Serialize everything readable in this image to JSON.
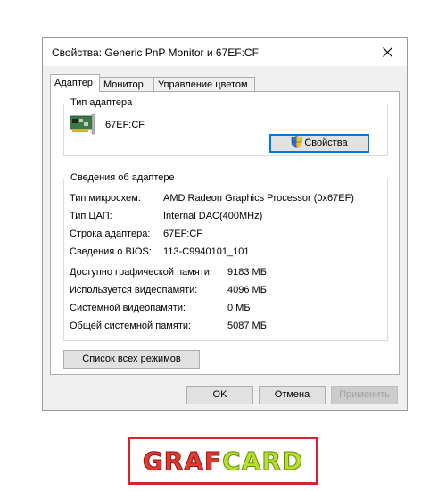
{
  "window": {
    "title": "Свойства: Generic PnP Monitor и 67EF:CF"
  },
  "tabs": [
    {
      "label": "Адаптер",
      "active": true
    },
    {
      "label": "Монитор",
      "active": false
    },
    {
      "label": "Управление цветом",
      "active": false
    }
  ],
  "adapter_type": {
    "group_title": "Тип адаптера",
    "name": "67EF:CF",
    "icon": "graphics-card-icon",
    "properties_button": "Свойства"
  },
  "adapter_info": {
    "group_title": "Сведения об адаптере",
    "rows": [
      {
        "key": "Тип микросхем:",
        "value": "AMD Radeon Graphics Processor (0x67EF)"
      },
      {
        "key": "Тип ЦАП:",
        "value": "Internal DAC(400MHz)"
      },
      {
        "key": "Строка адаптера:",
        "value": "67EF:CF"
      },
      {
        "key": "Сведения о BIOS:",
        "value": "113-C9940101_101"
      }
    ],
    "memory": [
      {
        "key": "Доступно графической памяти:",
        "value": "9183 МБ"
      },
      {
        "key": "Используется видеопамяти:",
        "value": "4096 МБ"
      },
      {
        "key": "Системной видеопамяти:",
        "value": "0 МБ"
      },
      {
        "key": "Общей системной памяти:",
        "value": "5087 МБ"
      }
    ]
  },
  "list_modes_button": "Список всех режимов",
  "footer": {
    "ok": "OK",
    "cancel": "Отмена",
    "apply": "Применить"
  },
  "logo": {
    "part1": "GRAF",
    "part2": "CARD",
    "colors": {
      "border": "#d9242b",
      "graf": "#e23a2f",
      "card": "#b8df2a"
    }
  },
  "colors": {
    "focus": "#0078d7",
    "dialog_bg": "#f0f0f0"
  }
}
